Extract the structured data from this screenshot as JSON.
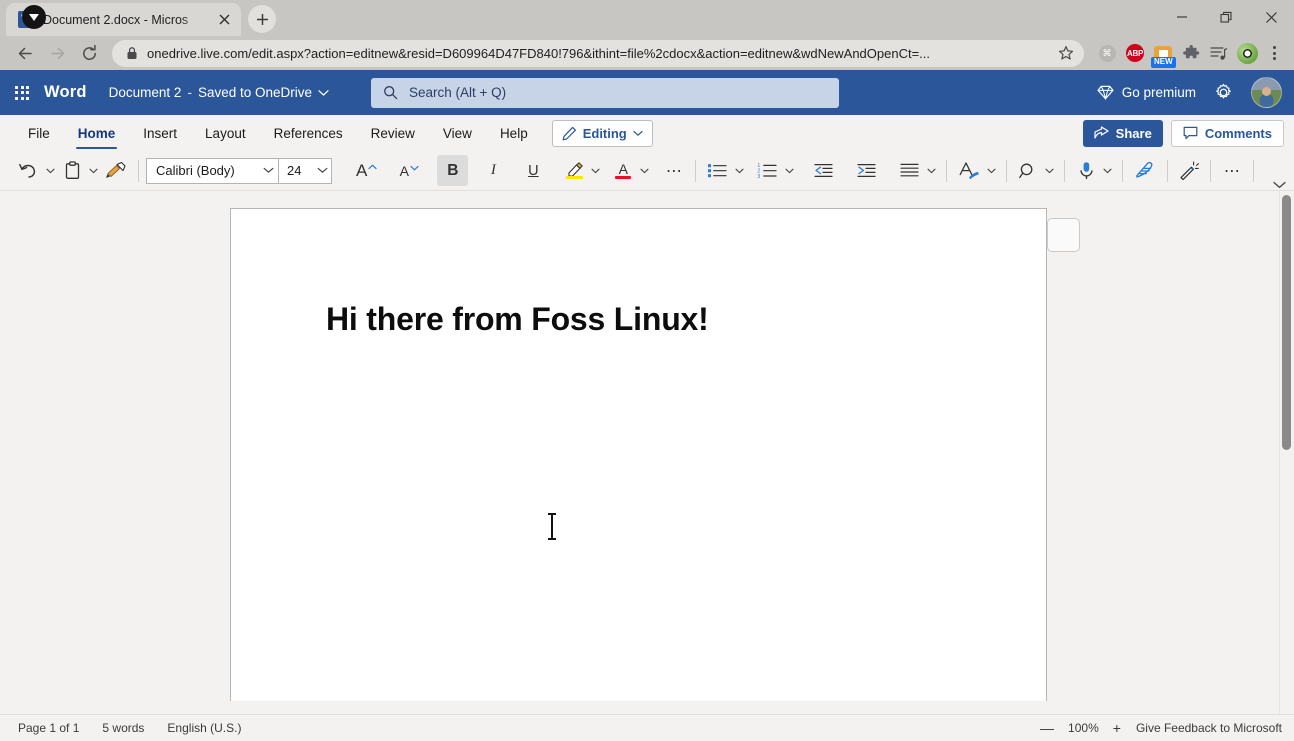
{
  "browser": {
    "tab": {
      "title": "Document 2.docx - Micros",
      "favicon_letter": "W",
      "close_icon": "close-icon"
    },
    "new_tab_label": "+",
    "nav": {
      "back_icon": "back-arrow-icon",
      "forward_icon": "forward-arrow-icon",
      "reload_icon": "reload-icon"
    },
    "omnibox": {
      "url": "onedrive.live.com/edit.aspx?action=editnew&resid=D609964D47FD840!796&ithint=file%2cdocx&action=editnew&wdNewAndOpenCt=...",
      "lock_icon": "lock-icon",
      "bookmark_icon": "star-icon"
    },
    "extensions": [
      {
        "name": "command-extension-icon",
        "label": "⌘"
      },
      {
        "name": "adblock-plus-icon",
        "label": "ABP"
      },
      {
        "name": "screenshot-extension-icon",
        "badge": "NEW"
      },
      {
        "name": "puzzle-extensions-icon"
      },
      {
        "name": "playlist-extension-icon"
      },
      {
        "name": "profile-avatar-icon"
      },
      {
        "name": "chrome-menu-icon"
      }
    ],
    "window_controls": {
      "download_indicator": "download-icon",
      "minimize": "—",
      "maximize": "❐",
      "close": "✕"
    }
  },
  "word_header": {
    "app_launcher_icon": "waffle-grid-icon",
    "brand": "Word",
    "document_name": "Document 2",
    "separator": "-",
    "save_status": "Saved to OneDrive",
    "title_chevron": "chevron-down-icon",
    "search": {
      "icon": "search-icon",
      "placeholder": "Search (Alt + Q)"
    },
    "go_premium": {
      "icon": "diamond-icon",
      "label": "Go premium"
    },
    "settings_icon": "gear-icon",
    "account_avatar": "account-avatar"
  },
  "ribbon": {
    "tabs": [
      {
        "label": "File",
        "active": false
      },
      {
        "label": "Home",
        "active": true
      },
      {
        "label": "Insert",
        "active": false
      },
      {
        "label": "Layout",
        "active": false
      },
      {
        "label": "References",
        "active": false
      },
      {
        "label": "Review",
        "active": false
      },
      {
        "label": "View",
        "active": false
      },
      {
        "label": "Help",
        "active": false
      }
    ],
    "editing_button": {
      "icon": "pencil-icon",
      "label": "Editing",
      "chevron": "chevron-down-icon"
    },
    "share_button": {
      "icon": "share-icon",
      "label": "Share"
    },
    "comments_button": {
      "icon": "comment-bubble-icon",
      "label": "Comments"
    }
  },
  "format_toolbar": {
    "undo": "undo-icon",
    "paste": "paste-clipboard-icon",
    "format_painter": "format-painter-icon",
    "font_name": "Calibri (Body)",
    "font_size": "24",
    "grow_font": "A",
    "shrink_font": "A",
    "bold": "B",
    "italic": "I",
    "underline": "U",
    "highlight_color": "#ffe600",
    "font_color_swatch": "#e81123",
    "more_font": "⋯",
    "bullets": "bulleted-list-icon",
    "numbering": "numbered-list-icon",
    "decrease_indent": "decrease-indent-icon",
    "increase_indent": "increase-indent-icon",
    "align": "align-icon",
    "styles": "styles-icon",
    "find": "find-icon",
    "dictate": "microphone-icon",
    "editor": "editor-icon",
    "designer": "magic-wand-icon",
    "more_tools": "⋯",
    "collapse_ribbon": "chevron-down-icon",
    "accent_blue": "#2b579a"
  },
  "document": {
    "heading": "Hi there from Foss Linux!",
    "margin_toggle": "margin-notes-toggle",
    "cursor": "text-cursor"
  },
  "status_bar": {
    "page_info": "Page 1 of 1",
    "word_count": "5 words",
    "language": "English (U.S.)",
    "zoom_out": "—",
    "zoom_level": "100%",
    "zoom_in": "+",
    "feedback": "Give Feedback to Microsoft"
  }
}
